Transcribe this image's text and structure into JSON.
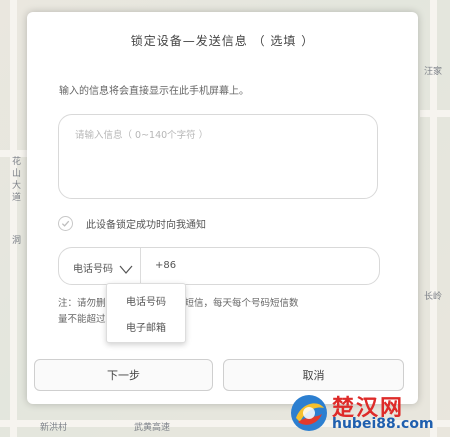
{
  "map": {
    "labels": [
      "汪家",
      "花",
      "山",
      "大",
      "道",
      "洞",
      "长岭",
      "武黄高速",
      "新洪村"
    ]
  },
  "dialog": {
    "title": "锁定设备—发送信息 （ 选填 ）",
    "hint": "输入的信息将会直接显示在此手机屏幕上。",
    "message_placeholder": "请输入信息（ 0~140个字符 ）",
    "notify_label": "此设备锁定成功时向我通知",
    "contact_type": "电话号码",
    "country_code": "+86",
    "notice_line1": "注：请勿删                   导致设备不能收到短信，每天每个号码短信数",
    "notice_line2": "量不能超过",
    "next_button": "下一步",
    "cancel_button": "取消"
  },
  "dropdown": {
    "options": [
      "电话号码",
      "电子邮箱"
    ]
  },
  "watermark": {
    "text": "楚汉网",
    "url": "hubei88.com"
  }
}
